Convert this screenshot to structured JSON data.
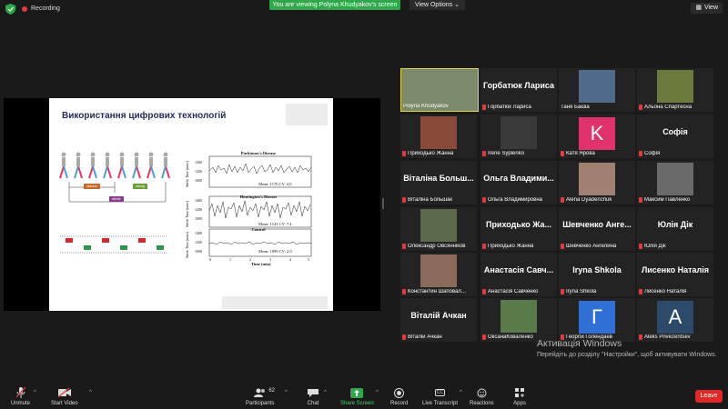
{
  "top": {
    "recording": "Recording",
    "viewing": "You are viewing Polyna Khudyakov's screen",
    "view_options": "View Options",
    "view": "View"
  },
  "slide": {
    "title": "Використання цифрових технологій",
    "gait_labels": [
      "stance",
      "swing",
      "stride"
    ],
    "graph1_title": "Parkinson's Disease",
    "graph1_stats": "Mean: 1176   CV: 4.9",
    "graph2_title": "Huntington's Disease",
    "graph2_stats": "Mean: 1143   CV: 7.4",
    "graph3_title": "Control",
    "graph3_stats": "Mean: 1099   CV: 2.0",
    "ylabel": "Stride Time (msec)",
    "xlabel": "Time (min)",
    "y_ticks_top": [
      "1400",
      "1200",
      "1000"
    ],
    "x_ticks": [
      "0",
      "1",
      "2",
      "3",
      "4",
      "5"
    ]
  },
  "tiles": [
    {
      "big": "",
      "name": "Polyna Khudyakov",
      "muted": false,
      "photo": true,
      "photo_color": "#7a8a6a"
    },
    {
      "big": "Горбатюк Лариса",
      "name": "Горбатюк Лариса",
      "muted": true,
      "photo": false
    },
    {
      "big": "",
      "name": "Таня Баєва",
      "muted": false,
      "photo": true,
      "photo_color": "#4e6b8a"
    },
    {
      "big": "",
      "name": "Альона Спартесна",
      "muted": true,
      "photo": true,
      "photo_color": "#6a7a3a"
    },
    {
      "big": "",
      "name": "Приходько Жанна",
      "muted": true,
      "photo": true,
      "photo_color": "#8a4a3a"
    },
    {
      "big": "",
      "name": "Irene Syplenko",
      "muted": true,
      "photo": true,
      "photo_color": "#3a3a3a"
    },
    {
      "big": "",
      "name": "Катя Ярова",
      "muted": true,
      "photo": false,
      "letter": "K",
      "letter_color": "#e0336e"
    },
    {
      "big": "Софія",
      "name": "Софія",
      "muted": true,
      "photo": false
    },
    {
      "big": "Віталіна Больш...",
      "name": "Віталіна Большак",
      "muted": true,
      "photo": false
    },
    {
      "big": "Ольга Владими...",
      "name": "Ольга Владимировна",
      "muted": true,
      "photo": false
    },
    {
      "big": "",
      "name": "Alena Dyadenchuk",
      "muted": true,
      "photo": true,
      "photo_color": "#a08070"
    },
    {
      "big": "",
      "name": "Максим Павленко",
      "muted": true,
      "photo": true,
      "photo_color": "#6a6a6a"
    },
    {
      "big": "",
      "name": "Олександр Овсянніков",
      "muted": true,
      "photo": true,
      "photo_color": "#5a6a4a"
    },
    {
      "big": "Приходько Жа...",
      "name": "Приходько Жанна",
      "muted": true,
      "photo": false
    },
    {
      "big": "Шевченко Анге...",
      "name": "Шевченко Ангелина",
      "muted": true,
      "photo": false
    },
    {
      "big": "Юлія Дік",
      "name": "Юлія Дік",
      "muted": true,
      "photo": false
    },
    {
      "big": "",
      "name": "Константин Шаповал...",
      "muted": true,
      "photo": true,
      "photo_color": "#8a6a5a"
    },
    {
      "big": "Анастасія Савч...",
      "name": "Анастасія Савченко",
      "muted": true,
      "photo": false
    },
    {
      "big": "Iryna Shkola",
      "name": "Iryna Shkola",
      "muted": true,
      "photo": false
    },
    {
      "big": "Лисенко Наталія",
      "name": "Лисенко Наталія",
      "muted": true,
      "photo": false
    },
    {
      "big": "Віталій Ачкан",
      "name": "Віталій Ачкан",
      "muted": true,
      "photo": false
    },
    {
      "big": "",
      "name": "ОксанаКоваленко",
      "muted": true,
      "photo": true,
      "photo_color": "#5a7a4a"
    },
    {
      "big": "",
      "name": "Георгій Голендаев",
      "muted": true,
      "photo": false,
      "letter": "Г",
      "letter_color": "#2f6fd6"
    },
    {
      "big": "",
      "name": "Aleks Privezentsev",
      "muted": true,
      "photo": false,
      "letter": "A",
      "letter_color": "#2d4a6a"
    }
  ],
  "watermark": {
    "line1": "Активація Windows",
    "line2": "Перейдіть до розділу \"Настройки\", щоб активувати Windows."
  },
  "toolbar": {
    "unmute": "Unmute",
    "start_video": "Start Video",
    "participants": "Participants",
    "participants_count": "62",
    "chat": "Chat",
    "share_screen": "Share Screen",
    "record": "Record",
    "live_transcript": "Live Transcript",
    "reactions": "Reactions",
    "apps": "Apps",
    "leave": "Leave",
    "cc": "CC"
  }
}
